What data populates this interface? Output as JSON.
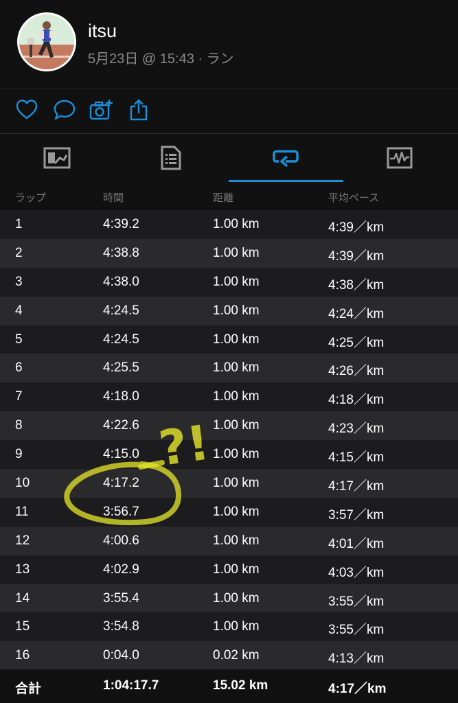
{
  "header": {
    "username": "itsu",
    "subtitle": "5月23日 @ 15:43 · ラン"
  },
  "colors": {
    "accent": "#1b8fd9",
    "highlight": "#e6e62a"
  },
  "actions": [
    {
      "icon": "heart-icon"
    },
    {
      "icon": "comment-icon"
    },
    {
      "icon": "add-photo-icon"
    },
    {
      "icon": "share-icon"
    }
  ],
  "tabs": [
    {
      "icon": "overview-icon"
    },
    {
      "icon": "details-icon"
    },
    {
      "icon": "laps-icon",
      "selected": true
    },
    {
      "icon": "chart-icon"
    }
  ],
  "table": {
    "headers": [
      "ラップ",
      "時間",
      "距離",
      "平均ペース"
    ],
    "rows": [
      [
        "1",
        "4:39.2",
        "1.00 km",
        "4:39／km"
      ],
      [
        "2",
        "4:38.8",
        "1.00 km",
        "4:39／km"
      ],
      [
        "3",
        "4:38.0",
        "1.00 km",
        "4:38／km"
      ],
      [
        "4",
        "4:24.5",
        "1.00 km",
        "4:24／km"
      ],
      [
        "5",
        "4:24.5",
        "1.00 km",
        "4:25／km"
      ],
      [
        "6",
        "4:25.5",
        "1.00 km",
        "4:26／km"
      ],
      [
        "7",
        "4:18.0",
        "1.00 km",
        "4:18／km"
      ],
      [
        "8",
        "4:22.6",
        "1.00 km",
        "4:23／km"
      ],
      [
        "9",
        "4:15.0",
        "1.00 km",
        "4:15／km"
      ],
      [
        "10",
        "4:17.2",
        "1.00 km",
        "4:17／km"
      ],
      [
        "11",
        "3:56.7",
        "1.00 km",
        "3:57／km"
      ],
      [
        "12",
        "4:00.6",
        "1.00 km",
        "4:01／km"
      ],
      [
        "13",
        "4:02.9",
        "1.00 km",
        "4:03／km"
      ],
      [
        "14",
        "3:55.4",
        "1.00 km",
        "3:55／km"
      ],
      [
        "15",
        "3:54.8",
        "1.00 km",
        "3:55／km"
      ],
      [
        "16",
        "0:04.0",
        "0.02 km",
        "4:13／km"
      ]
    ],
    "total": [
      "合計",
      "1:04:17.7",
      "15.02 km",
      "4:17／km"
    ]
  },
  "annotation": {
    "text": "?!"
  }
}
